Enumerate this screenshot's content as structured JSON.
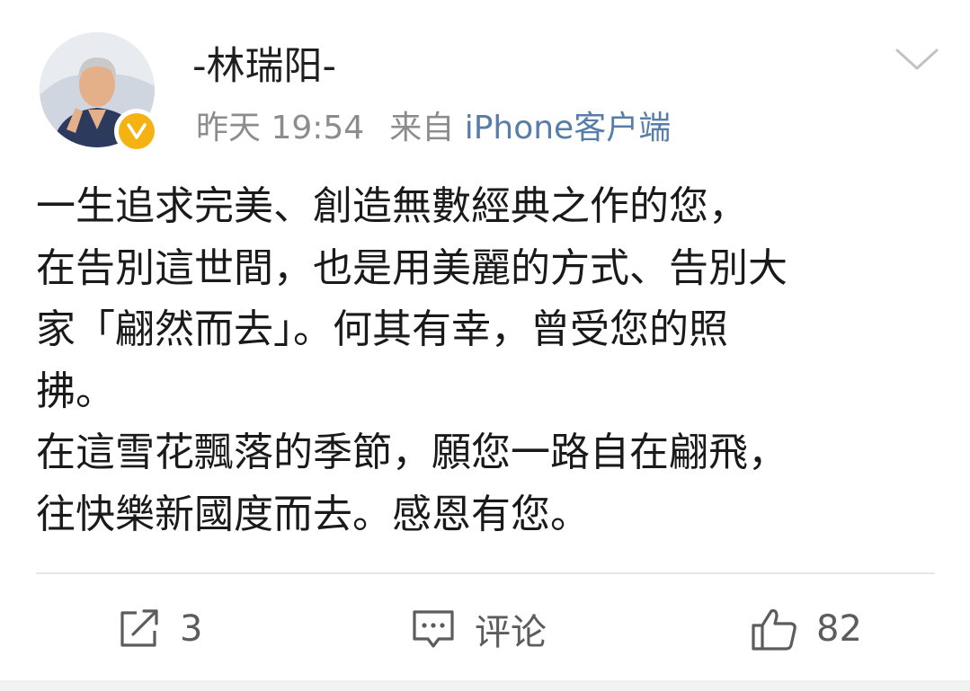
{
  "post": {
    "author": {
      "name": "-林瑞阳-",
      "avatar_icon": "avatar-photo",
      "verified_icon": "verified-v-badge-icon",
      "verified_color": "#f5b313"
    },
    "meta": {
      "date": "昨天",
      "time": "19:54",
      "source_prefix": "来自",
      "source_client": "iPhone客户端",
      "source_color": "#577da8"
    },
    "menu_icon": "chevron-down-icon",
    "body_lines": [
      "一生追求完美、創造無數經典之作的您，",
      "在告別這世間，也是用美麗的方式、告別大",
      "家「翩然而去」。何其有幸，曾受您的照",
      "拂。",
      "在這雪花飄落的季節，願您一路自在翩飛，",
      "往快樂新國度而去。感恩有您。"
    ]
  },
  "actions": {
    "repost": {
      "icon": "repost-icon",
      "count": "3"
    },
    "comment": {
      "icon": "comment-icon",
      "label": "评论"
    },
    "like": {
      "icon": "thumbs-up-icon",
      "count": "82"
    }
  }
}
